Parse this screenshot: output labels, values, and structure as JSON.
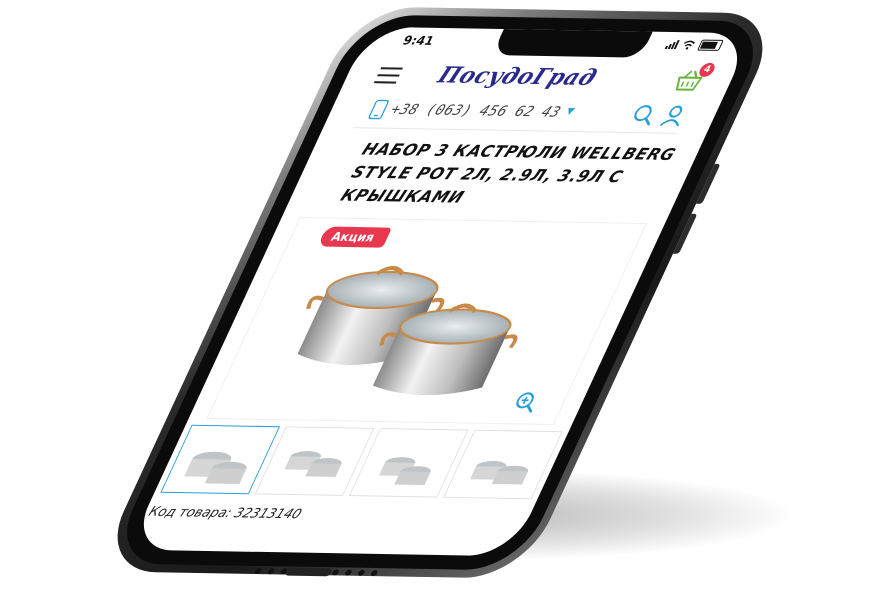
{
  "status_bar": {
    "time": "9:41"
  },
  "header": {
    "logo_text": "ПосудоГрад",
    "cart_count": "4"
  },
  "contact": {
    "phone": "+38 (063) 456 62 43"
  },
  "product": {
    "title": "Набор 3 кастрюли Wellberg Style Pot 2л, 2.9л, 3.9л с крышками",
    "sale_badge": "Акция",
    "code_label": "Код товара:",
    "code_value": "32313140",
    "thumbnails": [
      "thumb-1",
      "thumb-2",
      "thumb-3",
      "thumb-4"
    ]
  },
  "colors": {
    "brand": "#2b2a8c",
    "accent": "#2a9fd8",
    "sale": "#e8384f"
  },
  "icons": [
    "menu-icon",
    "cart-icon",
    "phone-icon",
    "chevron-down-icon",
    "search-icon",
    "user-icon",
    "zoom-in-icon"
  ]
}
